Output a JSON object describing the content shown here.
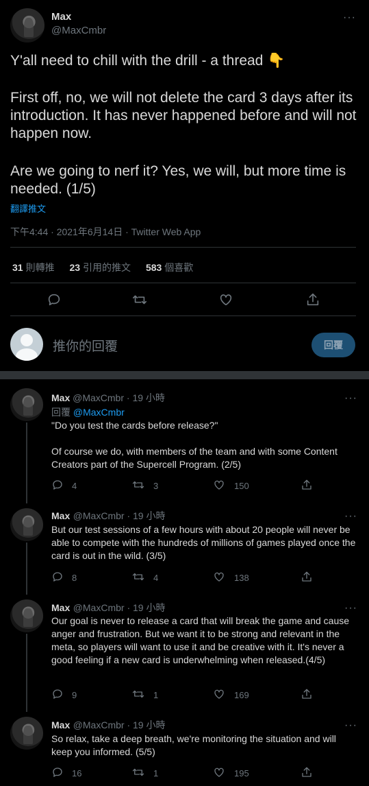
{
  "main_tweet": {
    "name": "Max",
    "handle": "@MaxCmbr",
    "more": "···",
    "text_line1": "Y'all need to chill with the drill - a thread 👇",
    "text_line2": "First off, no, we will not delete the card 3 days after its introduction. It has never happened before and will not happen now.",
    "text_line3": "Are we going to nerf it? Yes, we will, but more time is needed. (1/5)",
    "translate": "翻譯推文",
    "meta": "下午4:44 · 2021年6月14日 · Twitter Web App",
    "stats": {
      "retweets_count": "31",
      "retweets_label": "則轉推",
      "quotes_count": "23",
      "quotes_label": "引用的推文",
      "likes_count": "583",
      "likes_label": "個喜歡"
    }
  },
  "compose": {
    "placeholder": "推你的回覆",
    "button": "回覆"
  },
  "replies": [
    {
      "name": "Max",
      "handle_time": "@MaxCmbr · 19 小時",
      "replying_prefix": "回覆",
      "replying_to": "@MaxCmbr",
      "text": "\"Do you test the cards before release?\"\n\nOf course we do, with members of the team and with some Content Creators part of the Supercell Program. (2/5)",
      "replies": "4",
      "retweets": "3",
      "likes": "150"
    },
    {
      "name": "Max",
      "handle_time": "@MaxCmbr · 19 小時",
      "text": "But our test sessions of a few hours with about 20 people will never be able to compete with the hundreds of millions of games played once the card is out in the wild. (3/5)",
      "replies": "8",
      "retweets": "4",
      "likes": "138"
    },
    {
      "name": "Max",
      "handle_time": "@MaxCmbr · 19 小時",
      "text": "Our goal is never to release a card that will break the game and cause anger and frustration. But we want it to be strong and relevant in the meta, so players will want to use it and be creative with it. It's never a good feeling if a new card is underwhelming when released.(4/5)",
      "replies": "9",
      "retweets": "1",
      "likes": "169"
    },
    {
      "name": "Max",
      "handle_time": "@MaxCmbr · 19 小時",
      "text": "So relax, take a deep breath, we're monitoring the situation and will keep you informed. (5/5)",
      "replies": "16",
      "retweets": "1",
      "likes": "195"
    }
  ]
}
